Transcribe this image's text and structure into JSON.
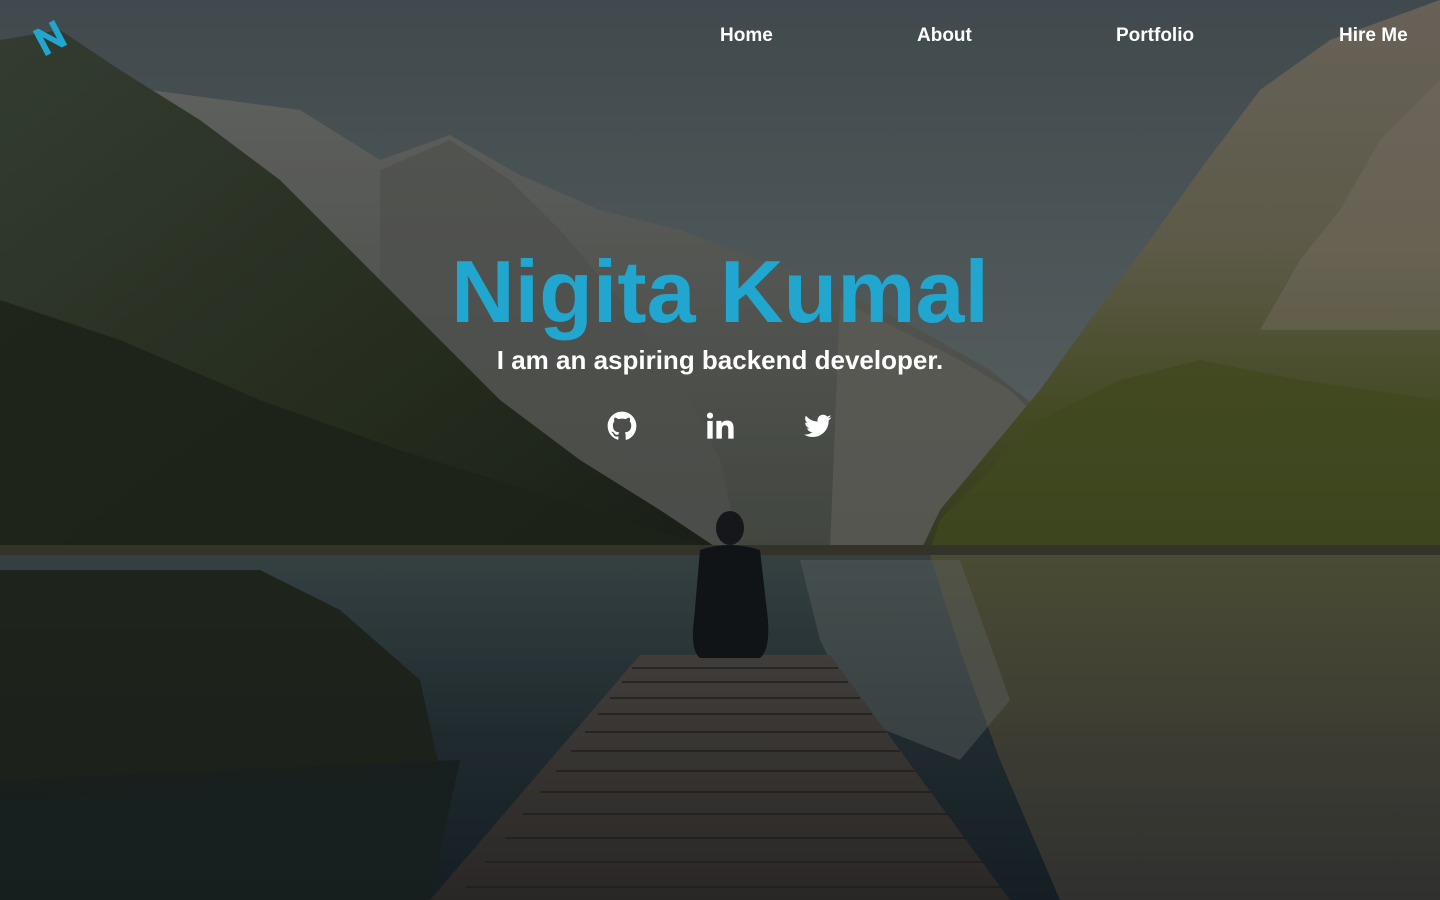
{
  "brand": {
    "logo_letter": "N",
    "accent_color": "#21a7cf"
  },
  "nav": {
    "items": [
      {
        "label": "Home"
      },
      {
        "label": "About"
      },
      {
        "label": "Portfolio"
      },
      {
        "label": "Hire Me"
      }
    ]
  },
  "hero": {
    "title": "Nigita Kumal",
    "subtitle": "I am an aspiring backend developer.",
    "background": "mountain-lake-dock-photo"
  },
  "socials": [
    {
      "icon": "github-icon"
    },
    {
      "icon": "linkedin-icon"
    },
    {
      "icon": "twitter-icon"
    }
  ]
}
